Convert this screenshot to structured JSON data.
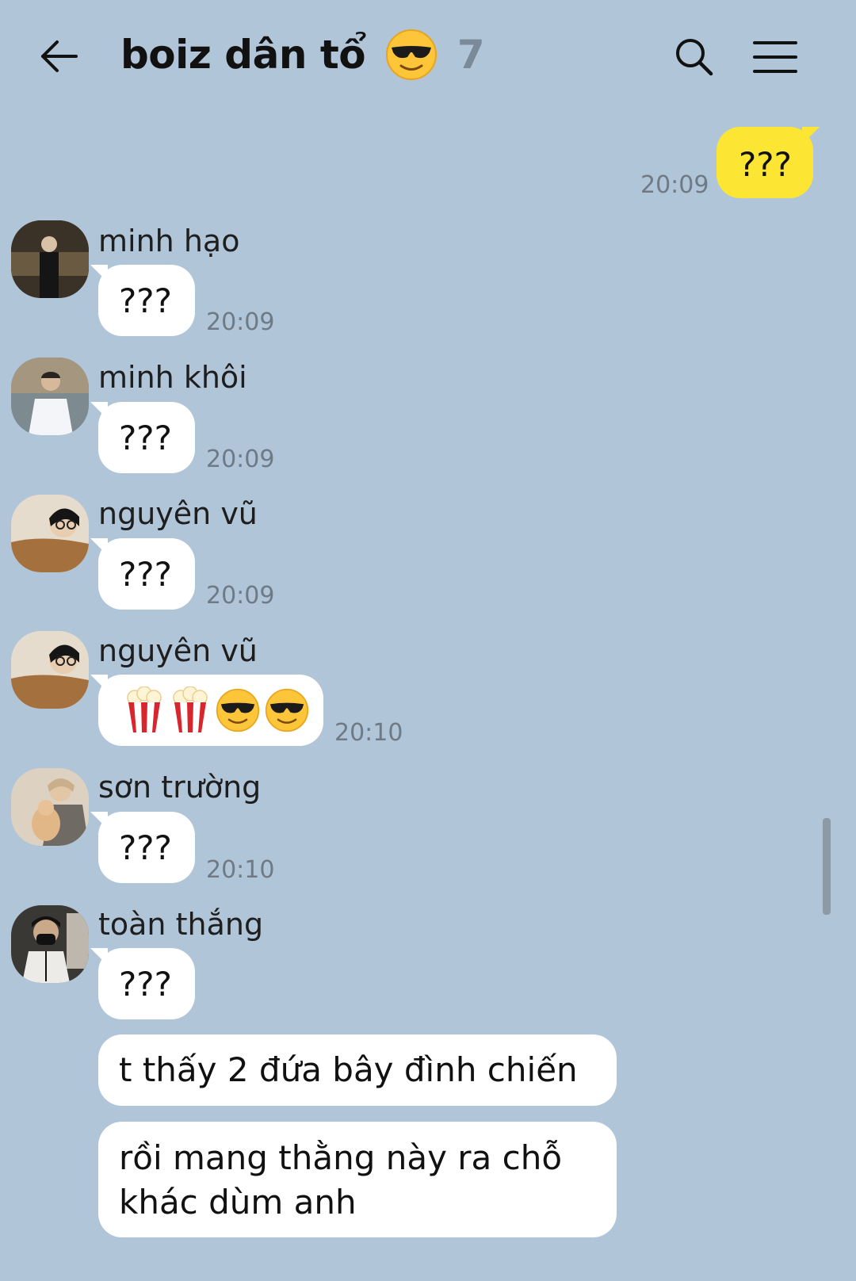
{
  "header": {
    "title": "boiz dân tổ",
    "member_count": "7"
  },
  "outgoing": [
    {
      "text": "???",
      "time": "20:09"
    }
  ],
  "messages": [
    {
      "sender": "minh hạo",
      "text": "???",
      "time": "20:09",
      "avatar_color": "#4a3c2c"
    },
    {
      "sender": "minh khôi",
      "text": "???",
      "time": "20:09",
      "avatar_color": "#8a7a66"
    },
    {
      "sender": "nguyên vũ",
      "text": "???",
      "time": "20:09",
      "avatar_color": "#c8a885"
    },
    {
      "sender": "nguyên vũ",
      "emojis": [
        "popcorn-icon",
        "popcorn-icon",
        "sunglasses-face-icon",
        "sunglasses-face-icon"
      ],
      "time": "20:10",
      "avatar_color": "#c8a885"
    },
    {
      "sender": "sơn trường",
      "text": "???",
      "time": "20:10",
      "avatar_color": "#b9a48c"
    },
    {
      "sender": "toàn thắng",
      "text": "???",
      "time": "",
      "avatar_color": "#3d3a36"
    }
  ],
  "followups": [
    {
      "text": "t thấy 2 đứa bây đình chiến"
    },
    {
      "text_line1": "rồi mang thằng này ra chỗ",
      "text_line2": "khác dùm anh"
    }
  ],
  "colors": {
    "background": "#b1c5d9",
    "outgoing_bubble": "#fde633",
    "incoming_bubble": "#ffffff",
    "timestamp": "#6e7a86"
  }
}
